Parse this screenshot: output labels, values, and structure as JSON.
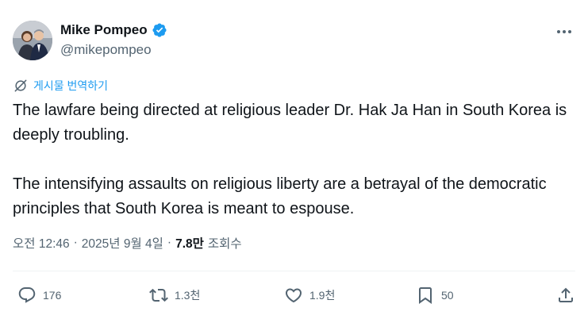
{
  "author": {
    "name": "Mike Pompeo",
    "handle": "@mikepompeo",
    "verified_color": "#1d9bf0"
  },
  "translate_label": "게시물 번역하기",
  "tweet": {
    "paragraphs": [
      "The lawfare being directed at religious leader Dr. Hak Ja Han in South Korea is deeply troubling.",
      "The intensifying assaults on religious liberty are a betrayal of the democratic principles that South Korea is meant to espouse."
    ]
  },
  "meta": {
    "time": "오전 12:46",
    "separator": "·",
    "date": "2025년 9월 4일",
    "views_count": "7.8만",
    "views_label": "조회수"
  },
  "actions": {
    "reply": {
      "icon": "reply-icon",
      "count": "176"
    },
    "repost": {
      "icon": "repost-icon",
      "count": "1.3천"
    },
    "like": {
      "icon": "heart-icon",
      "count": "1.9천"
    },
    "bookmark": {
      "icon": "bookmark-icon",
      "count": "50"
    },
    "share": {
      "icon": "share-icon"
    }
  },
  "colors": {
    "text": "#0f1419",
    "secondary": "#536471",
    "accent": "#1d9bf0"
  }
}
